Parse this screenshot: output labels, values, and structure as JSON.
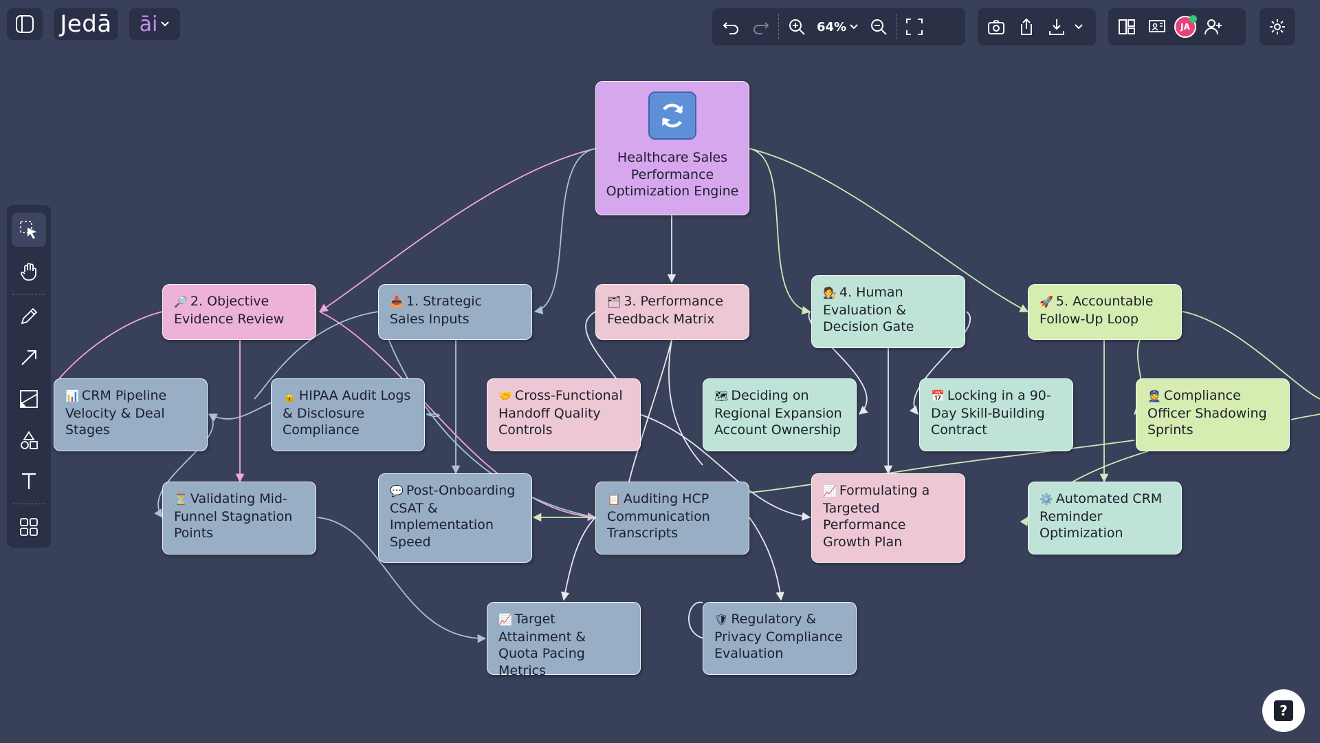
{
  "app": {
    "logo_text": "Jedā",
    "ai_label": "āi",
    "accent_color": "#c48ff0",
    "background_color": "#394059"
  },
  "top_toolbar": {
    "zoom_level": "64%",
    "avatar_initials": "JA",
    "avatar_color": "#e8437a",
    "presence_dot_color": "#2ecc71"
  },
  "icons": {
    "sidebar_toggle": "panel-left-icon",
    "undo": "undo-icon",
    "redo": "redo-icon",
    "zoom_in": "zoom-in-icon",
    "zoom_out": "zoom-out-icon",
    "fit": "fit-screen-icon",
    "camera": "camera-icon",
    "share": "share-icon",
    "download": "download-icon",
    "layout": "layout-icon",
    "present": "present-icon",
    "add_user": "add-user-icon",
    "settings": "gear-icon",
    "help": "help-icon"
  },
  "tools": [
    {
      "name": "select-tool",
      "icon": "select-icon",
      "active": true
    },
    {
      "name": "hand-tool",
      "icon": "hand-icon"
    },
    {
      "name": "pen-tool",
      "icon": "pen-icon"
    },
    {
      "name": "arrow-tool",
      "icon": "arrow-icon"
    },
    {
      "name": "image-tool",
      "icon": "image-icon"
    },
    {
      "name": "shapes-tool",
      "icon": "shapes-icon"
    },
    {
      "name": "text-tool",
      "icon": "text-icon"
    },
    {
      "name": "grid-tool",
      "icon": "grid-icon"
    }
  ],
  "nodes": {
    "root": {
      "icon": "refresh-icon",
      "label": "Healthcare Sales Performance Optimization Engine"
    },
    "n1": {
      "emoji": "📥",
      "label": "1. Strategic Sales Inputs"
    },
    "n2": {
      "emoji": "🔎",
      "label": "2. Objective Evidence Review"
    },
    "n3": {
      "emoji": "🗂",
      "label": "3. Performance Feedback Matrix"
    },
    "n4": {
      "emoji": "🧑‍⚖️",
      "label": "4. Human Evaluation & Decision Gate"
    },
    "n5": {
      "emoji": "🚀",
      "label": "5. Accountable Follow-Up Loop"
    },
    "crm": {
      "emoji": "📊",
      "label": "CRM Pipeline Velocity & Deal Stages"
    },
    "hipaa": {
      "emoji": "🔒",
      "label": "HIPAA Audit Logs & Disclosure Compliance"
    },
    "handoff": {
      "emoji": "🤝",
      "label": "Cross-Functional Handoff Quality Controls"
    },
    "regional": {
      "emoji": "🗺",
      "label": "Deciding on Regional Expansion Account Ownership"
    },
    "locking": {
      "emoji": "📅",
      "label": "Locking in a 90-Day Skill-Building Contract"
    },
    "shadow": {
      "emoji": "👮",
      "label": "Compliance Officer Shadowing Sprints"
    },
    "stagnation": {
      "emoji": "⏳",
      "label": "Validating Mid-Funnel Stagnation Points"
    },
    "csat": {
      "emoji": "💬",
      "label": "Post-Onboarding CSAT & Implementation Speed"
    },
    "auditing": {
      "emoji": "📋",
      "label": "Auditing HCP Communication Transcripts"
    },
    "growth": {
      "emoji": "📈",
      "label": "Formulating a Targeted Performance Growth Plan"
    },
    "reminder": {
      "emoji": "⚙️",
      "label": "Automated CRM Reminder Optimization"
    },
    "target": {
      "emoji": "📈",
      "label": "Target Attainment & Quota Pacing Metrics"
    },
    "regulatory": {
      "emoji": "🛡",
      "label": "Regulatory & Privacy Compliance Evaluation"
    }
  },
  "edge_colors": {
    "pink": "#f0a8d6",
    "blue": "#a9c2dc",
    "green": "#cfe9b8",
    "white": "#e6e8ef"
  }
}
